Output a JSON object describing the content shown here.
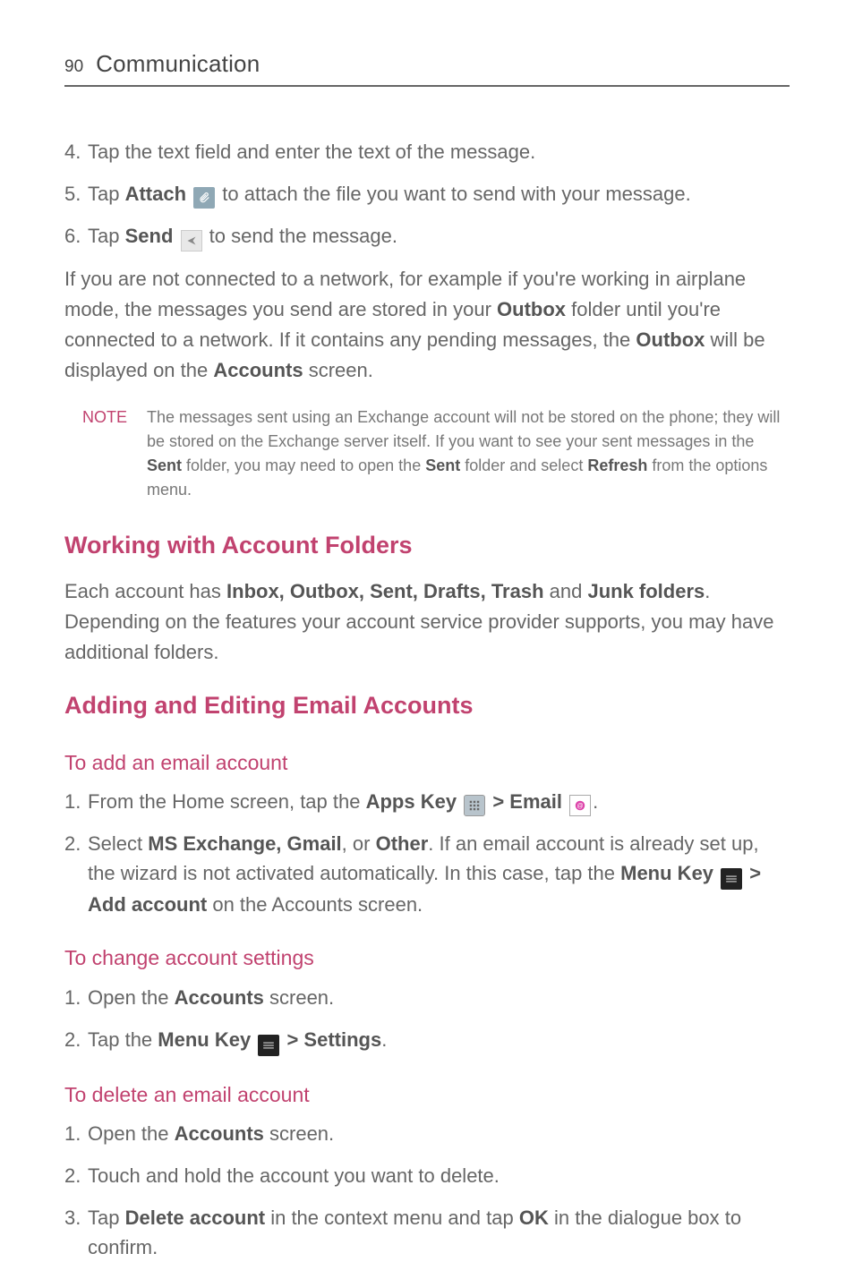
{
  "header": {
    "page_number": "90",
    "title": "Communication"
  },
  "steps_top": [
    {
      "num": "4.",
      "pre": "Tap the text field and enter the text of the message."
    },
    {
      "num": "5.",
      "t1": "Tap ",
      "b1": "Attach",
      "t2": " to attach the file you want to send with your message."
    },
    {
      "num": "6.",
      "t1": "Tap ",
      "b1": "Send",
      "t2": " to send the message."
    }
  ],
  "para1": {
    "t1": "If you are not connected to a network, for example if you're working in airplane mode, the messages you send are stored in your ",
    "b1": "Outbox",
    "t2": " folder until you're connected to a network. If it contains any pending messages, the ",
    "b2": "Outbox",
    "t3": " will be displayed on the ",
    "b3": "Accounts",
    "t4": " screen."
  },
  "note": {
    "label": "NOTE",
    "t1": "The messages sent using an Exchange account will not be stored on the phone; they will be stored on the Exchange server itself. If you want to see your sent messages in the ",
    "b1": "Sent",
    "t2": " folder, you may need to open the ",
    "b2": "Sent",
    "t3": " folder and select ",
    "b3": "Refresh",
    "t4": " from the options menu."
  },
  "h2_folders": "Working with Account Folders",
  "folders_p": {
    "t1": "Each account has ",
    "b1": "Inbox, Outbox, Sent, Drafts, Trash",
    "t2": " and ",
    "b2": "Junk folders",
    "t3": ". Depending on the features your account service provider supports, you may have additional folders."
  },
  "h2_adding": "Adding and Editing Email Accounts",
  "h3_add": "To add an email account",
  "add_steps": [
    {
      "num": "1.",
      "t1": "From the Home screen, tap the ",
      "b1": "Apps Key",
      "t2": " > ",
      "b2": "Email",
      "t3": "."
    },
    {
      "num": "2.",
      "t1": "Select ",
      "b1": "MS Exchange, Gmail",
      "t2": ", or ",
      "b2": "Other",
      "t3": ". If an email account is already set up, the wizard is not activated automatically. In this case, tap the ",
      "b3": "Menu Key",
      "t4": " > ",
      "b4": "Add account",
      "t5": " on the Accounts screen."
    }
  ],
  "h3_change": "To change account settings",
  "change_steps": [
    {
      "num": "1.",
      "t1": "Open the ",
      "b1": "Accounts",
      "t2": " screen."
    },
    {
      "num": "2.",
      "t1": "Tap the ",
      "b1": "Menu Key",
      "t2": " > ",
      "b2": "Settings",
      "t3": "."
    }
  ],
  "h3_delete": "To delete an email account",
  "delete_steps": [
    {
      "num": "1.",
      "t1": "Open the ",
      "b1": "Accounts",
      "t2": " screen."
    },
    {
      "num": "2.",
      "t1": "Touch and hold the account you want to delete."
    },
    {
      "num": "3.",
      "t1": "Tap ",
      "b1": "Delete account",
      "t2": " in the context menu and tap ",
      "b2": "OK",
      "t3": " in the dialogue box to confirm."
    }
  ]
}
